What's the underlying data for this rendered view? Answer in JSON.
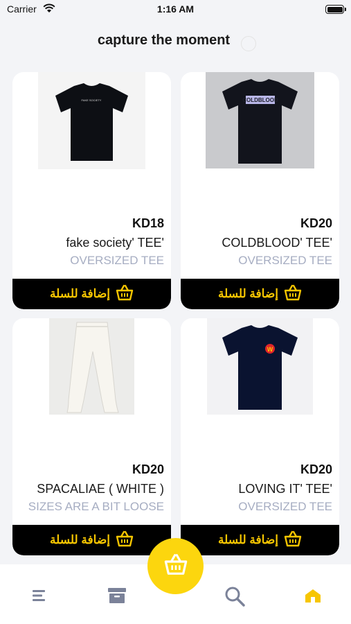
{
  "status_bar": {
    "carrier": "Carrier",
    "time": "1:16 AM"
  },
  "header": {
    "title": "capture the moment"
  },
  "products": [
    {
      "price": "KD18",
      "name": "fake society' TEE'",
      "subtitle": "OVERSIZED TEE",
      "cart_label": "إضافة للسلة",
      "image": "black-tshirt-photo"
    },
    {
      "price": "KD20",
      "name": "COLDBLOOD' TEE'",
      "subtitle": "OVERSIZED TEE",
      "cart_label": "إضافة للسلة",
      "image": "black-tshirt-photo"
    },
    {
      "price": "KD20",
      "name": "SPACALIAE ( WHITE )",
      "subtitle": "SIZES ARE A BIT LOOSE",
      "cart_label": "إضافة للسلة",
      "image": "white-pants-photo"
    },
    {
      "price": "KD20",
      "name": "LOVING IT' TEE'",
      "subtitle": "OVERSIZED TEE",
      "cart_label": "إضافة للسلة",
      "image": "black-tshirt-photo"
    }
  ],
  "tshirt_prints": [
    "FAKE SOCIETY",
    "COLDBLOOD",
    "W"
  ],
  "bottom_nav": {
    "items": [
      "menu-icon",
      "archive-icon",
      "search-icon",
      "home-icon"
    ],
    "fab": "basket-icon"
  },
  "colors": {
    "accent": "#fcd60e",
    "cart_text": "#f7c600",
    "cart_bar": "#000000",
    "subtitle": "#a6adc2",
    "active_nav": "#f7c600",
    "inactive_nav": "#7b8299"
  }
}
